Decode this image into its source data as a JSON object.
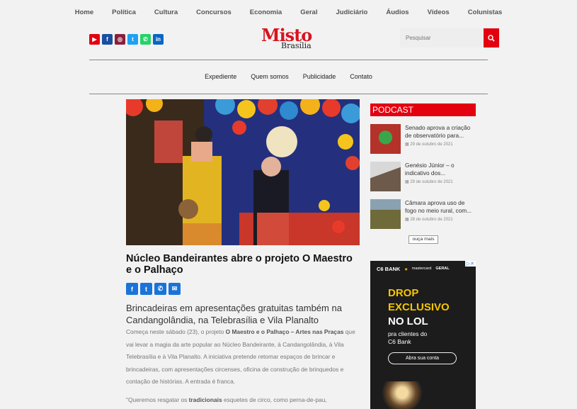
{
  "topnav": [
    "Home",
    "Política",
    "Cultura",
    "Concursos",
    "Economia",
    "Geral",
    "Judiciário",
    "Áudios",
    "Vídeos",
    "Colunistas"
  ],
  "logo": {
    "line1": "Misto",
    "line2": "Brasília"
  },
  "search": {
    "placeholder": "Pesquisar"
  },
  "social": [
    {
      "name": "youtube-icon",
      "glyph": "▶",
      "color": "#e3000f"
    },
    {
      "name": "facebook-icon",
      "glyph": "f",
      "color": "#1a4fa0"
    },
    {
      "name": "instagram-icon",
      "glyph": "◎",
      "color": "#8a1f3d"
    },
    {
      "name": "twitter-icon",
      "glyph": "t",
      "color": "#1da1f2"
    },
    {
      "name": "whatsapp-icon",
      "glyph": "✆",
      "color": "#25d366"
    },
    {
      "name": "linkedin-icon",
      "glyph": "in",
      "color": "#0a66c2"
    }
  ],
  "secnav": [
    "Expediente",
    "Quem somos",
    "Publicidade",
    "Contato"
  ],
  "article": {
    "title": "Núcleo Bandeirantes abre o projeto O Maestro e o Palhaço",
    "subtitle": "Brincadeiras em apresentações gratuitas também na Candangolândia, na Telebrasília e Vila Planalto",
    "p1_a": "Começa neste sábado (23), o projeto ",
    "p1_b": "O Maestro e o Palhaço – Artes nas Praças",
    "p1_c": " que vai levar a magia da arte popular ao Núcleo Bandeirante, à Candangolândia, à Vila Telebrasília e à Vila Planalto. A iniciativa pretende retomar espaços de brincar e brincadeiras, com apresentações circenses, oficina de construção de brinquedos e contação de histórias. A entrada é franca.",
    "p2_a": "\"Queremos resgatar os ",
    "p2_b": "tradicionais",
    "p2_c": " esquetes de circo, como perna-de-pau,"
  },
  "share": [
    {
      "name": "facebook-share-icon",
      "glyph": "f"
    },
    {
      "name": "twitter-share-icon",
      "glyph": "t"
    },
    {
      "name": "whatsapp-share-icon",
      "glyph": "✆"
    },
    {
      "name": "email-share-icon",
      "glyph": "✉"
    }
  ],
  "podcast": {
    "heading": "PODCAST",
    "items": [
      {
        "title": "Senado aprova a criação de observatório para...",
        "date": "29 de outubro de 2021"
      },
      {
        "title": "Genésio Júnior – o indicativo dos...",
        "date": "29 de outubro de 2021"
      },
      {
        "title": "Câmara aprova uso de fogo no meio rural, com...",
        "date": "28 de outubro de 2021"
      }
    ],
    "more": "ouça mais"
  },
  "ad": {
    "brand": "C6 BANK",
    "partner1": "mastercard",
    "partner2": "GERAL",
    "line1": "DROP",
    "line2": "EXCLUSIVO",
    "line3": "NO LOL",
    "line4": "pra clientes do",
    "line5": "C6 Bank",
    "cta": "Abra sua conta"
  }
}
